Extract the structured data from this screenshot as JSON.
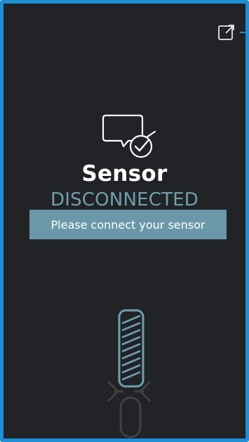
{
  "app": {
    "title": "Sensor",
    "status": "DISCONNECTED",
    "message_button_label": "Please connect your sensor"
  },
  "icons": {
    "external_link": "external-link-icon",
    "status": "chat-check-icon",
    "sensor": "sensor-probe-icon"
  },
  "colors": {
    "background": "#222327",
    "frame_border": "#1f8fd6",
    "accent": "#6a98a8",
    "status_text": "#6e9fae",
    "title_text": "#ffffff",
    "sensor_outline": "#6e9fae",
    "sensor_dim": "#3f4044"
  }
}
